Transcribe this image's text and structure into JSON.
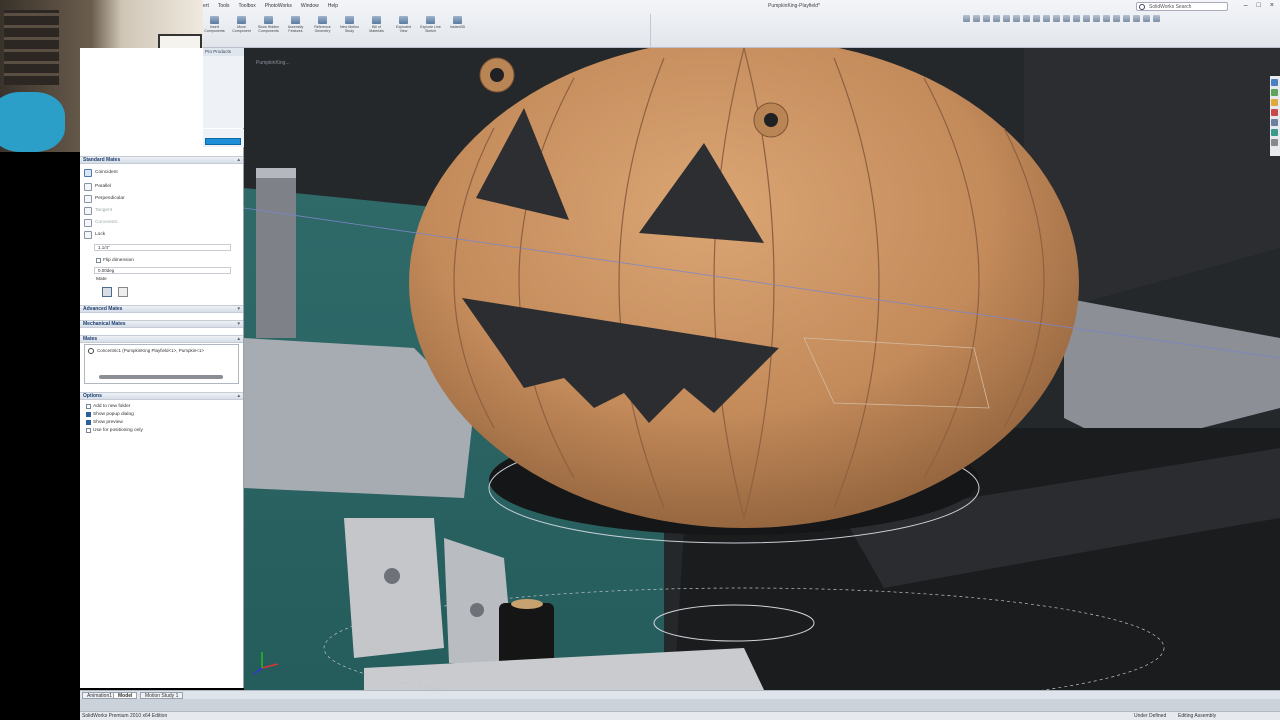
{
  "app": {
    "doc_title": "PumpkinKing-Playfield*",
    "search_placeholder": "SolidWorks Search",
    "window_controls": {
      "minimize": "–",
      "restore": "□",
      "close": "×"
    }
  },
  "menu": [
    "ert",
    "Tools",
    "Toolbox",
    "PhotoWorks",
    "Window",
    "Help"
  ],
  "ribbon_tools": [
    "Insert Components",
    "Move Component",
    "Show Hidden Components",
    "Assembly Features",
    "Reference Geometry",
    "New Motion Study",
    "Bill of Materials",
    "Exploded View",
    "Explode Line Sketch",
    "Instant3D"
  ],
  "property_manager": {
    "tab_label": "Pro Products",
    "standard_mates": {
      "header": "Standard Mates",
      "items": [
        {
          "label": "Coincident"
        },
        {
          "label": "Parallel"
        },
        {
          "label": "Perpendicular"
        },
        {
          "label": "Tangent"
        },
        {
          "label": "Concentric"
        },
        {
          "label": "Lock"
        }
      ],
      "distance_value": "1.1/4\"",
      "flip_dimension": "Flip dimension",
      "angle_value": "0.00deg",
      "alignment_label": "Mate"
    },
    "advanced_mates": {
      "header": "Advanced Mates"
    },
    "mechanical_mates": {
      "header": "Mechanical Mates"
    },
    "mates": {
      "header": "Mates",
      "items": [
        "Concentric1 (PumpkinKing Playfield<1>, Pumpkin<1>"
      ]
    },
    "options": {
      "header": "Options",
      "items": [
        {
          "label": "Add to new folder",
          "checked": false
        },
        {
          "label": "Show popup dialog",
          "checked": true
        },
        {
          "label": "Show preview",
          "checked": true
        },
        {
          "label": "Use for positioning only",
          "checked": false
        }
      ]
    }
  },
  "viewport": {
    "title": "PumpkinKing..."
  },
  "bottom_tabs": [
    "Animation1",
    "Model",
    "Motion Study 1"
  ],
  "status_bar": {
    "app_version": "SolidWorks Premium 2010 x64 Edition",
    "state": "Under Defined",
    "mode": "Editing Assembly"
  }
}
